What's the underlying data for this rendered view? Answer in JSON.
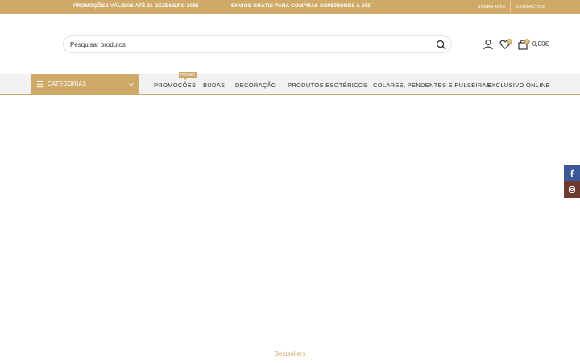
{
  "topbar": {
    "promo_1": "PROMOÇÕES VÁLIDAS ATÉ 31 DEZEMBRO 2025",
    "promo_2": "ENVIOS GRÁTIS PARA COMPRAS SUPERIORES A 50€",
    "links": [
      "SOBRE NÓS",
      "CONTACTOS"
    ]
  },
  "search": {
    "placeholder": "Pesquisar produtos"
  },
  "header": {
    "wishlist_count": "0",
    "cart_count": "0",
    "cart_total": "0,00€"
  },
  "nav": {
    "categories_label": "CATEGORIAS",
    "promo_tag": "PROMO",
    "items": [
      "PROMOÇÕES",
      "BUDAS",
      "DECORAÇÃO",
      "PRODUTOS ESOTÉRICOS",
      "COLARES, PENDENTES E PULSEIRAS",
      "EXCLUSIVO ONLINE"
    ]
  },
  "main": {
    "section_title": "Bestsellers"
  },
  "colors": {
    "accent": "#cfa968",
    "facebook": "#3b5998",
    "instagram": "#6e3a2f"
  },
  "icons": [
    "search-icon",
    "user-icon",
    "heart-icon",
    "cart-icon",
    "menu-icon",
    "chevron-down-icon",
    "facebook-icon",
    "instagram-icon"
  ]
}
